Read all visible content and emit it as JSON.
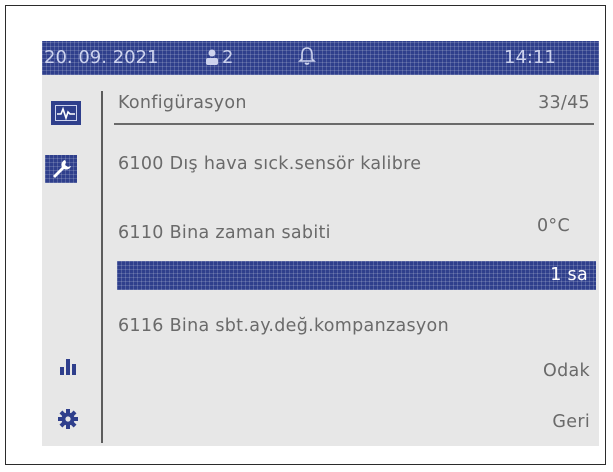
{
  "status_bar": {
    "date": "20. 09. 2021",
    "user_count": "2",
    "time": "14:11"
  },
  "sidebar": {
    "items": [
      {
        "icon": "monitor-icon",
        "selected": false
      },
      {
        "icon": "wrench-icon",
        "selected": true
      },
      {
        "icon": "bar-chart-icon",
        "selected": false
      },
      {
        "icon": "gear-icon",
        "selected": false
      }
    ]
  },
  "header": {
    "title": "Konfigürasyon",
    "page": "33/45"
  },
  "params": {
    "row1": "6100  Dış hava sıck.sensör kalibre",
    "row1_value": "0°C",
    "row2": "6110 Bina zaman sabiti",
    "row2_value": "1 sa",
    "row3": "6116  Bina sbt.ay.değ.kompanzasyon"
  },
  "softkeys": {
    "odak": "Odak",
    "geri": "Geri"
  },
  "colors": {
    "accent": "#2f3f8c",
    "screen_bg": "#e7e7e7",
    "text": "#6a6a6a"
  }
}
